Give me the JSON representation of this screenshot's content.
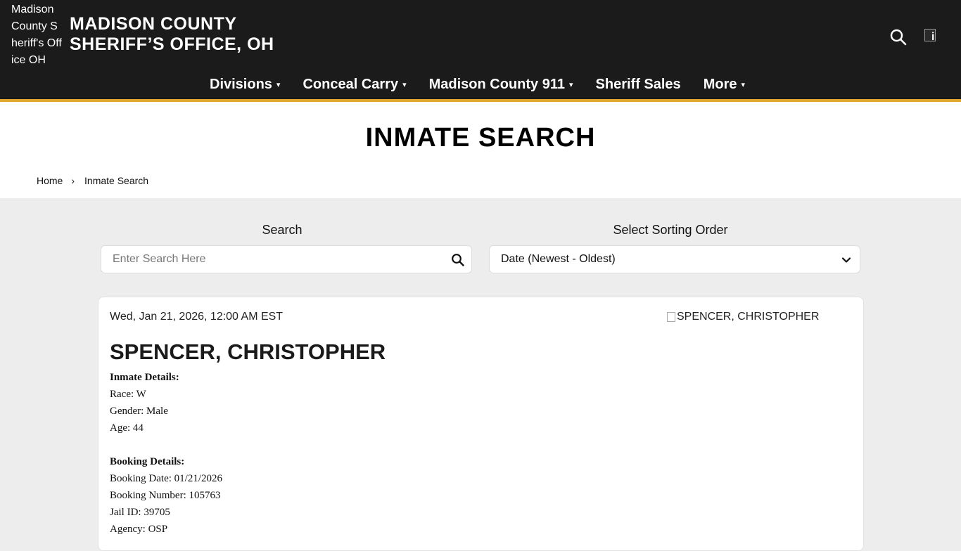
{
  "header": {
    "logo_alt": "Madison County Sheriff's Office OH",
    "site_title_line1": "MADISON COUNTY",
    "site_title_line2": "SHERIFF’S OFFICE, OH",
    "search_icon": "search-icon",
    "broken_image_icon": "broken-image-icon"
  },
  "nav": {
    "items": [
      {
        "label": "Divisions",
        "has_dropdown": true
      },
      {
        "label": "Conceal Carry",
        "has_dropdown": true
      },
      {
        "label": "Madison County 911",
        "has_dropdown": true
      },
      {
        "label": "Sheriff Sales",
        "has_dropdown": false
      },
      {
        "label": "More",
        "has_dropdown": true
      }
    ],
    "caret": "▾"
  },
  "page": {
    "title": "INMATE SEARCH",
    "breadcrumb": {
      "home": "Home",
      "separator": "›",
      "current": "Inmate Search"
    }
  },
  "search": {
    "label": "Search",
    "placeholder": "Enter Search Here",
    "value": ""
  },
  "sort": {
    "label": "Select Sorting Order",
    "selected": "Date (Newest - Oldest)"
  },
  "record": {
    "date": "Wed, Jan 21, 2026, 12:00 AM EST",
    "photo_alt": "SPENCER, CHRISTOPHER",
    "name": "SPENCER, CHRISTOPHER",
    "inmate_details_heading": "Inmate Details:",
    "race": "Race: W",
    "gender": "Gender: Male",
    "age": "Age: 44",
    "booking_details_heading": "Booking Details:",
    "booking_date": "Booking Date: 01/21/2026",
    "booking_number": "Booking Number: 105763",
    "jail_id": "Jail ID: 39705",
    "agency": "Agency: OSP"
  },
  "colors": {
    "header_bg": "#1b1b1b",
    "accent": "#e0a82e",
    "page_bg": "#ededed"
  }
}
